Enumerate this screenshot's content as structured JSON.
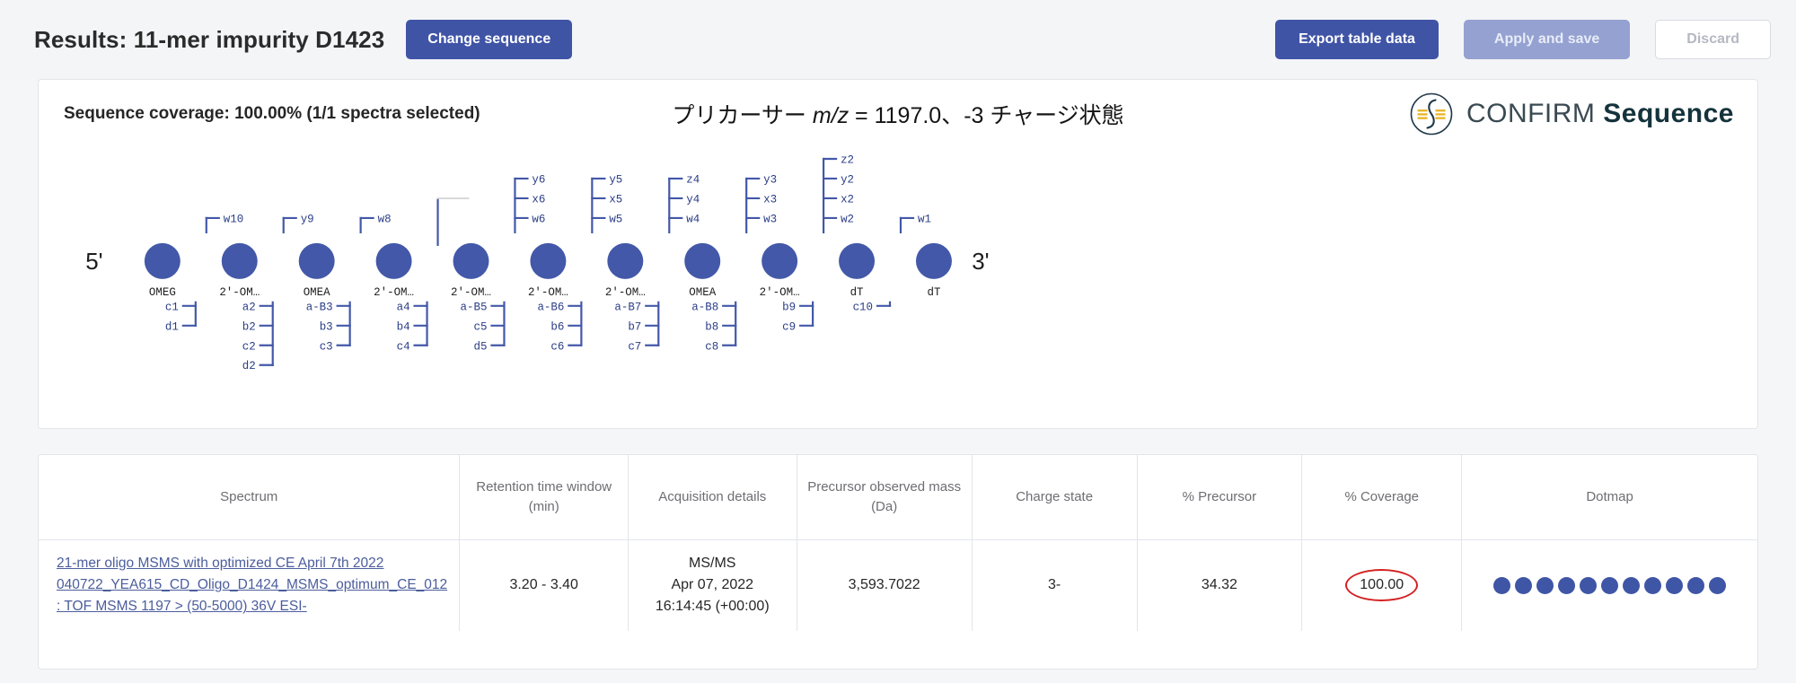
{
  "header": {
    "title": "Results: 11-mer impurity D1423",
    "change_sequence_label": "Change sequence",
    "export_label": "Export table data",
    "apply_label": "Apply and save",
    "discard_label": "Discard",
    "primary_color": "#4054a6",
    "disabled_color": "#94a1d1"
  },
  "sequence_panel": {
    "coverage_text": "Sequence coverage: 100.00% (1/1 spectra selected)",
    "precursor_prefix": "プリカーサー ",
    "precursor_mz_italic": "m/z",
    "precursor_suffix": " = 1197.0、-3 チャージ状態",
    "logo_text_light": "CONFIRM ",
    "logo_text_bold": "Sequence",
    "five_prime": "5'",
    "three_prime": "3'",
    "residue_color": "#4358a8",
    "bases": [
      {
        "index": 1,
        "label": "OMEG",
        "top_ions": [],
        "bottom_ions": [
          "c1",
          "d1"
        ]
      },
      {
        "index": 2,
        "label": "2'-OM…",
        "top_ions": [
          "w10"
        ],
        "bottom_ions": [
          "a2",
          "b2",
          "c2",
          "d2"
        ]
      },
      {
        "index": 3,
        "label": "OMEA",
        "top_ions": [
          "y9"
        ],
        "bottom_ions": [
          "a-B3",
          "b3",
          "c3"
        ]
      },
      {
        "index": 4,
        "label": "2'-OM…",
        "top_ions": [
          "w8"
        ],
        "bottom_ions": [
          "a4",
          "b4",
          "c4"
        ]
      },
      {
        "index": 5,
        "label": "2'-OM…",
        "top_ions": [],
        "bottom_ions": [
          "a-B5",
          "c5",
          "d5"
        ]
      },
      {
        "index": 6,
        "label": "2'-OM…",
        "top_ions": [
          "y6",
          "x6",
          "w6"
        ],
        "bottom_ions": [
          "a-B6",
          "b6",
          "c6"
        ]
      },
      {
        "index": 7,
        "label": "2'-OM…",
        "top_ions": [
          "y5",
          "x5",
          "w5"
        ],
        "bottom_ions": [
          "a-B7",
          "b7",
          "c7"
        ]
      },
      {
        "index": 8,
        "label": "OMEA",
        "top_ions": [
          "z4",
          "y4",
          "w4"
        ],
        "bottom_ions": [
          "a-B8",
          "b8",
          "c8"
        ]
      },
      {
        "index": 9,
        "label": "2'-OM…",
        "top_ions": [
          "y3",
          "x3",
          "w3"
        ],
        "bottom_ions": [
          "b9",
          "c9"
        ]
      },
      {
        "index": 10,
        "label": "dT",
        "top_ions": [
          "z2",
          "y2",
          "x2",
          "w2"
        ],
        "bottom_ions": [
          "c10"
        ]
      },
      {
        "index": 11,
        "label": "dT",
        "top_ions": [
          "w1"
        ],
        "bottom_ions": []
      }
    ]
  },
  "table": {
    "columns": [
      "Spectrum",
      "Retention time window (min)",
      "Acquisition details",
      "Precursor observed mass (Da)",
      "Charge state",
      "% Precursor",
      "% Coverage",
      "Dotmap"
    ],
    "rows": [
      {
        "spectrum": "21-mer oligo MSMS with optimized CE April 7th 2022 040722_YEA615_CD_Oligo_D1424_MSMS_optimum_CE_012: TOF MSMS 1197 > (50-5000) 36V ESI-",
        "retention_time": "3.20 - 3.40",
        "acq_type": "MS/MS",
        "acq_date": "Apr 07, 2022",
        "acq_time": "16:14:45 (+00:00)",
        "precursor_mass": "3,593.7022",
        "charge_state": "3-",
        "percent_precursor": "34.32",
        "percent_coverage": "100.00",
        "dotmap_count": 11,
        "highlight_color": "#d42222"
      }
    ]
  }
}
